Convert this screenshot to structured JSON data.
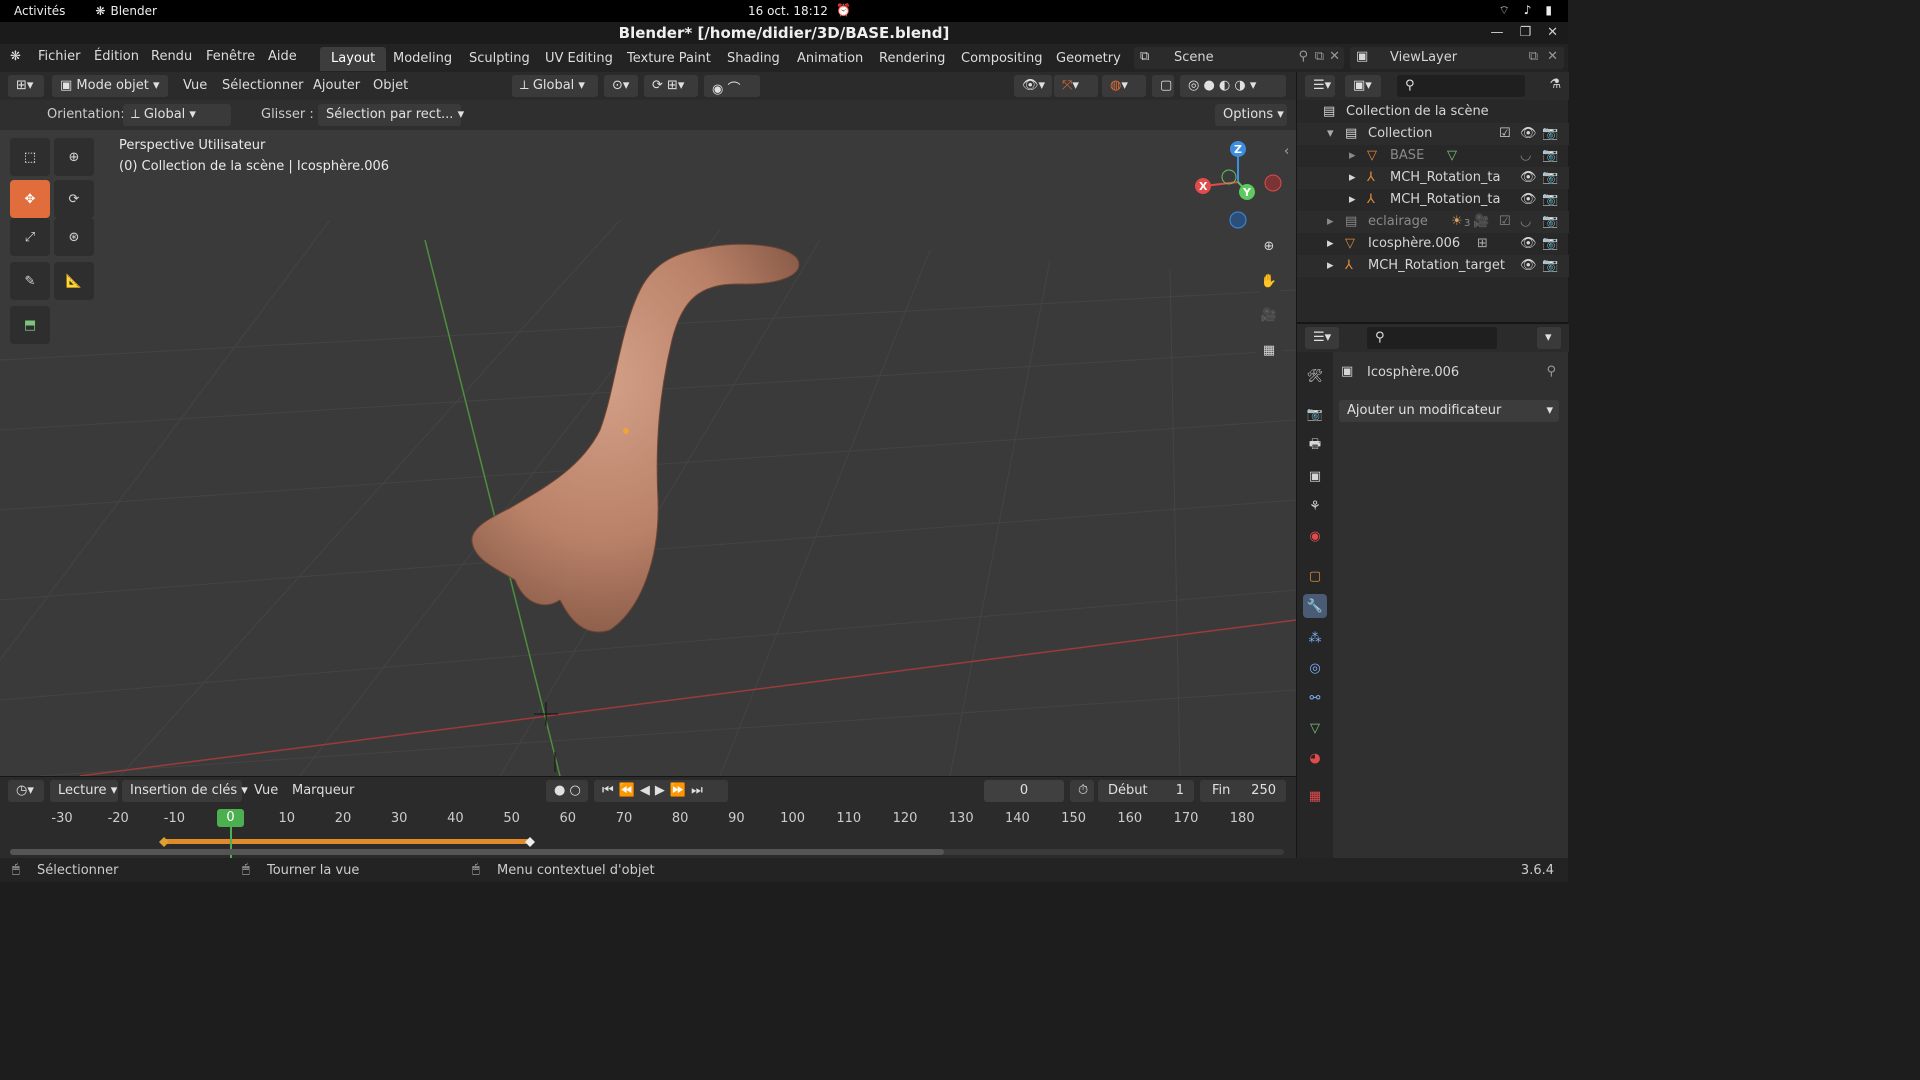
{
  "system_bar": {
    "activities": "Activités",
    "app_name": "Blender",
    "clock": "16 oct.  18:12"
  },
  "window": {
    "title": "Blender* [/home/didier/3D/BASE.blend]"
  },
  "menu": {
    "items": [
      "Fichier",
      "Édition",
      "Rendu",
      "Fenêtre",
      "Aide"
    ]
  },
  "workspaces": {
    "tabs": [
      "Layout",
      "Modeling",
      "Sculpting",
      "UV Editing",
      "Texture Paint",
      "Shading",
      "Animation",
      "Rendering",
      "Compositing",
      "Geometry N"
    ],
    "active": "Layout"
  },
  "scene": {
    "name": "Scene",
    "view_layer": "ViewLayer"
  },
  "viewport_header": {
    "mode": "Mode objet",
    "menus": [
      "Vue",
      "Sélectionner",
      "Ajouter",
      "Objet"
    ],
    "transform_orientation": "Global"
  },
  "tool_settings": {
    "orientation_label": "Orientation:",
    "orientation_value": "Global",
    "drag_label": "Glisser :",
    "drag_value": "Sélection par rect...",
    "options_label": "Options"
  },
  "viewport": {
    "view_name": "Perspective Utilisateur",
    "collection_info": "(0) Collection de la scène | Icosphère.006",
    "gizmo": {
      "x": "X",
      "y": "Y",
      "z": "Z"
    }
  },
  "outliner": {
    "root": "Collection de la scène",
    "rows": [
      {
        "name": "Collection"
      },
      {
        "name": "BASE"
      },
      {
        "name": "MCH_Rotation_ta"
      },
      {
        "name": "MCH_Rotation_ta"
      },
      {
        "name": "eclairage",
        "badge": "3"
      },
      {
        "name": "Icosphère.006"
      },
      {
        "name": "MCH_Rotation_target"
      }
    ]
  },
  "properties": {
    "object_name": "Icosphère.006",
    "add_modifier": "Ajouter un modificateur"
  },
  "timeline": {
    "playback": "Lecture",
    "keying": "Insertion de clés",
    "view": "Vue",
    "marker": "Marqueur",
    "current_frame": "0",
    "start_label": "Début",
    "start_value": "1",
    "end_label": "Fin",
    "end_value": "250",
    "ticks": [
      "-30",
      "-20",
      "-10",
      "0",
      "10",
      "20",
      "30",
      "40",
      "50",
      "60",
      "70",
      "80",
      "90",
      "100",
      "110",
      "120",
      "130",
      "140",
      "150",
      "160",
      "170",
      "180"
    ]
  },
  "status_bar": {
    "select": "Sélectionner",
    "rotate_view": "Tourner la vue",
    "context_menu": "Menu contextuel d'objet",
    "version": "3.6.4"
  },
  "colors": {
    "accent_orange": "#e06d3b",
    "axis_x": "#e04b4b",
    "axis_y": "#5ec95e",
    "axis_z": "#3d8ee0",
    "model_skin": "#b98168"
  }
}
